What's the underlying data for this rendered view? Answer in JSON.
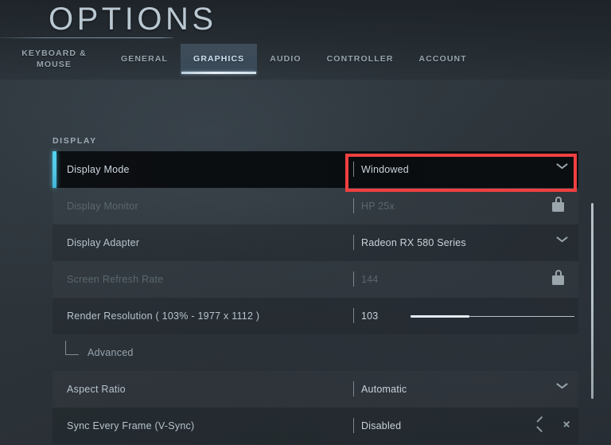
{
  "header": {
    "title": "OPTIONS",
    "tabs": [
      {
        "id": "keyboard-mouse",
        "line1": "KEYBOARD &",
        "line2": "MOUSE",
        "active": false
      },
      {
        "id": "general",
        "line1": "GENERAL",
        "line2": "",
        "active": false
      },
      {
        "id": "graphics",
        "line1": "GRAPHICS",
        "line2": "",
        "active": true
      },
      {
        "id": "audio",
        "line1": "AUDIO",
        "line2": "",
        "active": false
      },
      {
        "id": "controller",
        "line1": "CONTROLLER",
        "line2": "",
        "active": false
      },
      {
        "id": "account",
        "line1": "ACCOUNT",
        "line2": "",
        "active": false
      }
    ]
  },
  "section": {
    "label": "DISPLAY"
  },
  "settings": [
    {
      "id": "display-mode",
      "label": "Display Mode",
      "value": "Windowed",
      "control": "dropdown",
      "selected": true,
      "disabled": false,
      "highlighted": true
    },
    {
      "id": "display-monitor",
      "label": "Display Monitor",
      "value": "HP 25x",
      "control": "locked",
      "selected": false,
      "disabled": true,
      "highlighted": false
    },
    {
      "id": "display-adapter",
      "label": "Display Adapter",
      "value": "Radeon RX 580 Series",
      "control": "dropdown",
      "selected": false,
      "disabled": false,
      "highlighted": false
    },
    {
      "id": "screen-refresh-rate",
      "label": "Screen Refresh Rate",
      "value": "144",
      "control": "locked",
      "selected": false,
      "disabled": true,
      "highlighted": false
    },
    {
      "id": "render-resolution",
      "label": "Render Resolution ( 103% - 1977 x 1112 )",
      "value": "103",
      "control": "slider",
      "slider_percent": 36,
      "selected": false,
      "disabled": false,
      "highlighted": false
    },
    {
      "id": "advanced",
      "label": "Advanced",
      "value": "",
      "control": "sub-item",
      "selected": false,
      "disabled": false,
      "highlighted": false
    },
    {
      "id": "aspect-ratio",
      "label": "Aspect Ratio",
      "value": "Automatic",
      "control": "dropdown",
      "selected": false,
      "disabled": false,
      "highlighted": false
    },
    {
      "id": "sync-every-frame",
      "label": "Sync Every Frame (V-Sync)",
      "value": "Disabled",
      "control": "stepper",
      "selected": false,
      "disabled": false,
      "highlighted": false
    }
  ],
  "colors": {
    "accent_cyan": "#4fd5f0",
    "highlight_red": "#f04040",
    "background": "#2e363c",
    "tab_active_text": "#cfe2f2"
  }
}
